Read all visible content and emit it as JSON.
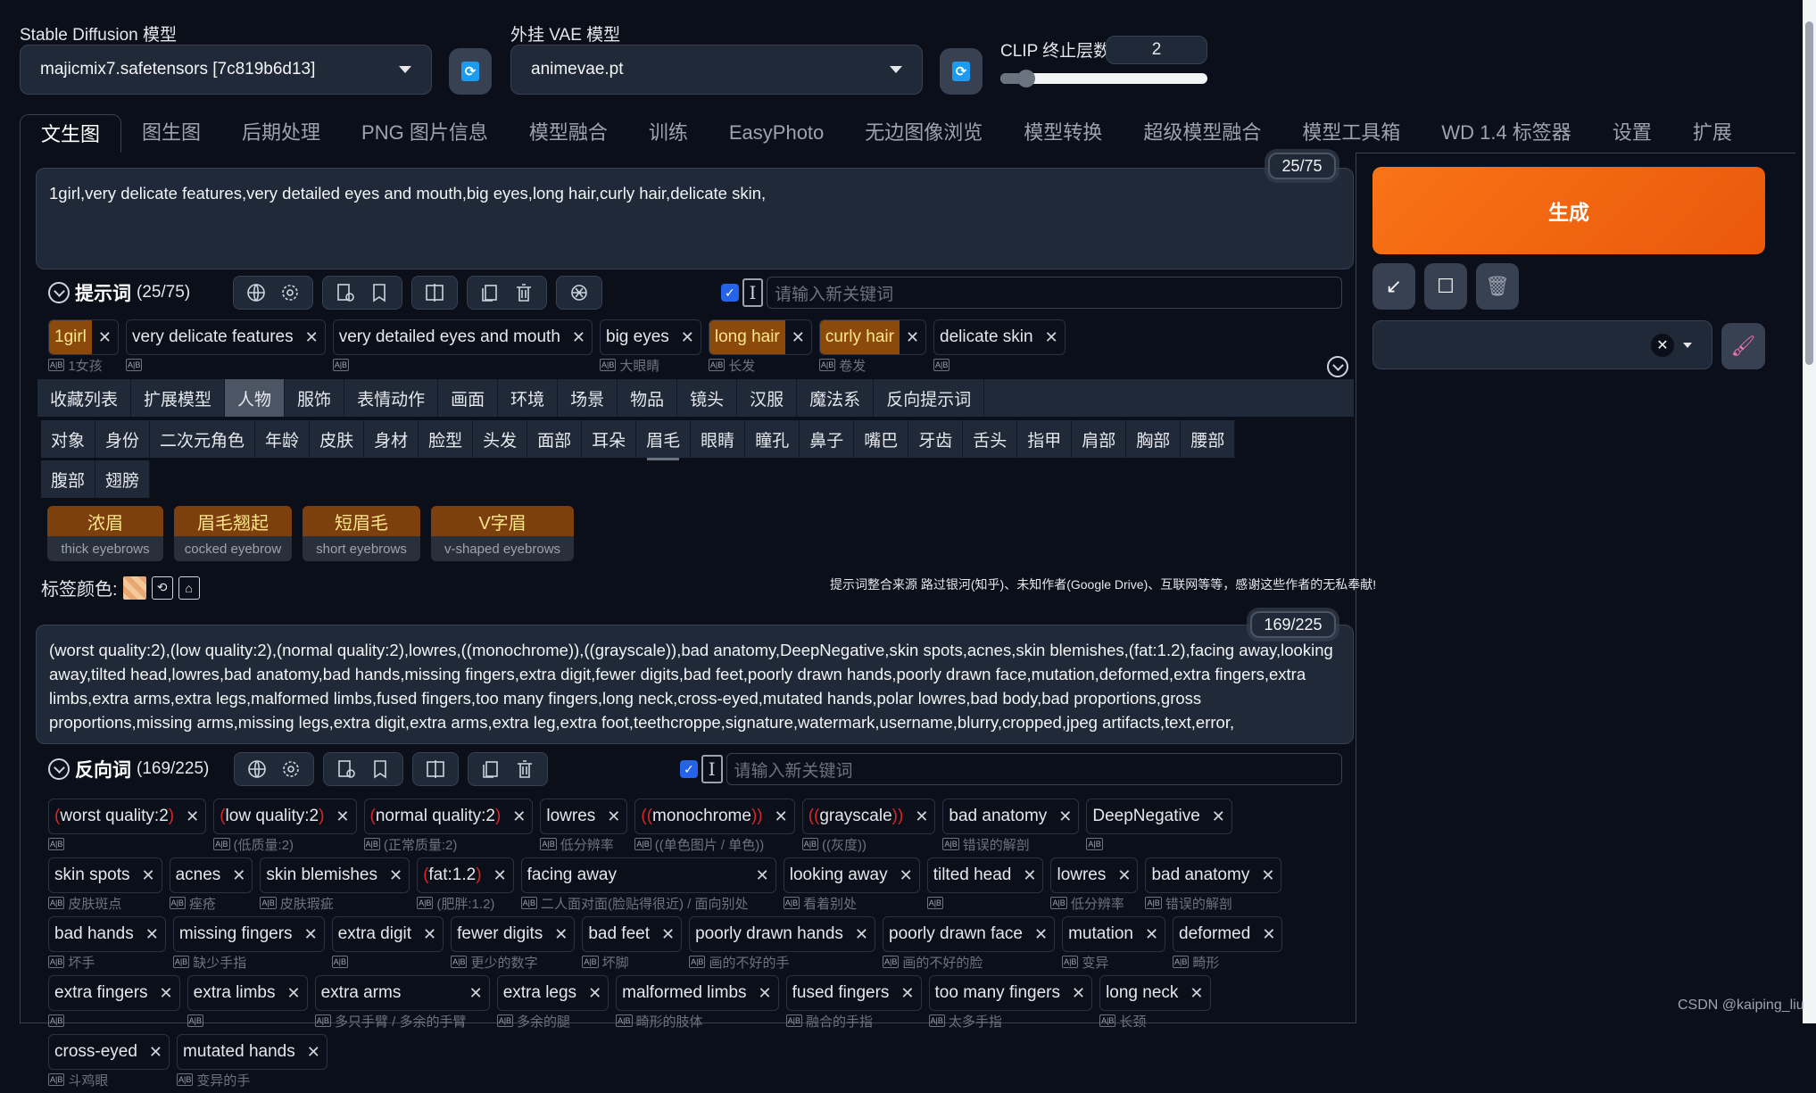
{
  "header": {
    "sd_model_label": "Stable Diffusion 模型",
    "sd_model_value": "majicmix7.safetensors [7c819b6d13]",
    "vae_label": "外挂 VAE 模型",
    "vae_value": "animevae.pt",
    "clip_label": "CLIP 终止层数",
    "clip_value": "2",
    "clip_slider_fraction": 0.08
  },
  "tabs": [
    "文生图",
    "图生图",
    "后期处理",
    "PNG 图片信息",
    "模型融合",
    "训练",
    "EasyPhoto",
    "无边图像浏览",
    "模型转换",
    "超级模型融合",
    "模型工具箱",
    "WD 1.4 标签器",
    "设置",
    "扩展"
  ],
  "active_tab": "文生图",
  "prompt": {
    "text": "1girl,very delicate features,very detailed eyes and mouth,big eyes,long hair,curly hair,delicate skin,",
    "token_count": "25/75",
    "section_title": "提示词",
    "section_count": "(25/75)",
    "keyword_placeholder": "请输入新关键词",
    "tags": [
      {
        "text": "1girl",
        "trans": "1女孩",
        "highlight": true
      },
      {
        "text": "very delicate features",
        "trans": "",
        "highlight": false
      },
      {
        "text": "very detailed eyes and mouth",
        "trans": "",
        "highlight": false
      },
      {
        "text": "big eyes",
        "trans": "大眼睛",
        "highlight": false
      },
      {
        "text": "long hair",
        "trans": "长发",
        "highlight": true
      },
      {
        "text": "curly hair",
        "trans": "卷发",
        "highlight": true
      },
      {
        "text": "delicate skin",
        "trans": "",
        "highlight": false
      }
    ]
  },
  "categories": [
    "收藏列表",
    "扩展模型",
    "人物",
    "服饰",
    "表情动作",
    "画面",
    "环境",
    "场景",
    "物品",
    "镜头",
    "汉服",
    "魔法系",
    "反向提示词"
  ],
  "active_category": "人物",
  "subcategories": [
    "对象",
    "身份",
    "二次元角色",
    "年龄",
    "皮肤",
    "身材",
    "脸型",
    "头发",
    "面部",
    "耳朵",
    "眉毛",
    "眼睛",
    "瞳孔",
    "鼻子",
    "嘴巴",
    "牙齿",
    "舌头",
    "指甲",
    "肩部",
    "胸部",
    "腰部",
    "腹部",
    "翅膀"
  ],
  "active_subcategory": "眉毛",
  "cards": [
    {
      "zh": "浓眉",
      "en": "thick eyebrows"
    },
    {
      "zh": "眉毛翘起",
      "en": "cocked eyebrow"
    },
    {
      "zh": "短眉毛",
      "en": "short eyebrows"
    },
    {
      "zh": "V字眉",
      "en": "v-shaped eyebrows"
    }
  ],
  "tag_color_label": "标签颜色:",
  "credits": "提示词整合来源 路过银河(知乎)、未知作者(Google Drive)、互联网等等，感谢这些作者的无私奉献!",
  "negative": {
    "text": "(worst quality:2),(low quality:2),(normal quality:2),lowres,((monochrome)),((grayscale)),bad anatomy,DeepNegative,skin spots,acnes,skin blemishes,(fat:1.2),facing away,looking away,tilted head,lowres,bad anatomy,bad hands,missing fingers,extra digit,fewer digits,bad feet,poorly drawn hands,poorly drawn face,mutation,deformed,extra fingers,extra limbs,extra arms,extra legs,malformed limbs,fused fingers,too many fingers,long neck,cross-eyed,mutated hands,polar lowres,bad body,bad proportions,gross proportions,missing arms,missing legs,extra digit,extra arms,extra leg,extra foot,teethcroppe,signature,watermark,username,blurry,cropped,jpeg artifacts,text,error,",
    "token_count": "169/225",
    "section_title": "反向词",
    "section_count": "(169/225)",
    "keyword_placeholder": "请输入新关键词",
    "tags": [
      {
        "pre": "(",
        "text": "worst quality:2",
        "post": ")",
        "trans": ""
      },
      {
        "pre": "(",
        "text": "low quality:2",
        "post": ")",
        "trans": "(低质量:2)"
      },
      {
        "pre": "(",
        "text": "normal quality:2",
        "post": ")",
        "trans": "(正常质量:2)"
      },
      {
        "pre": "",
        "text": "lowres",
        "post": "",
        "trans": "低分辨率"
      },
      {
        "pre": "((",
        "text": "monochrome",
        "post": "))",
        "trans": "((单色图片 / 单色))"
      },
      {
        "pre": "((",
        "text": "grayscale",
        "post": "))",
        "trans": "((灰度))"
      },
      {
        "pre": "",
        "text": "bad anatomy",
        "post": "",
        "trans": "错误的解剖"
      },
      {
        "pre": "",
        "text": "DeepNegative",
        "post": "",
        "trans": ""
      },
      {
        "pre": "",
        "text": "skin spots",
        "post": "",
        "trans": "皮肤斑点"
      },
      {
        "pre": "",
        "text": "acnes",
        "post": "",
        "trans": "痤疮"
      },
      {
        "pre": "",
        "text": "skin blemishes",
        "post": "",
        "trans": "皮肤瑕疵"
      },
      {
        "pre": "(",
        "text": "fat:1.2",
        "post": ")",
        "trans": "(肥胖:1.2)"
      },
      {
        "pre": "",
        "text": "facing away",
        "post": "",
        "trans": "二人面对面(脸贴得很近) / 面向别处"
      },
      {
        "pre": "",
        "text": "looking away",
        "post": "",
        "trans": "看着别处"
      },
      {
        "pre": "",
        "text": "tilted head",
        "post": "",
        "trans": ""
      },
      {
        "pre": "",
        "text": "lowres",
        "post": "",
        "trans": "低分辨率"
      },
      {
        "pre": "",
        "text": "bad anatomy",
        "post": "",
        "trans": "错误的解剖"
      },
      {
        "pre": "",
        "text": "bad hands",
        "post": "",
        "trans": "坏手"
      },
      {
        "pre": "",
        "text": "missing fingers",
        "post": "",
        "trans": "缺少手指"
      },
      {
        "pre": "",
        "text": "extra digit",
        "post": "",
        "trans": ""
      },
      {
        "pre": "",
        "text": "fewer digits",
        "post": "",
        "trans": "更少的数字"
      },
      {
        "pre": "",
        "text": "bad feet",
        "post": "",
        "trans": "坏脚"
      },
      {
        "pre": "",
        "text": "poorly drawn hands",
        "post": "",
        "trans": "画的不好的手"
      },
      {
        "pre": "",
        "text": "poorly drawn face",
        "post": "",
        "trans": "画的不好的脸"
      },
      {
        "pre": "",
        "text": "mutation",
        "post": "",
        "trans": "变异"
      },
      {
        "pre": "",
        "text": "deformed",
        "post": "",
        "trans": "畸形"
      },
      {
        "pre": "",
        "text": "extra fingers",
        "post": "",
        "trans": ""
      },
      {
        "pre": "",
        "text": "extra limbs",
        "post": "",
        "trans": ""
      },
      {
        "pre": "",
        "text": "extra arms",
        "post": "",
        "trans": "多只手臂 / 多余的手臂"
      },
      {
        "pre": "",
        "text": "extra legs",
        "post": "",
        "trans": "多余的腿"
      },
      {
        "pre": "",
        "text": "malformed limbs",
        "post": "",
        "trans": "畸形的肢体"
      },
      {
        "pre": "",
        "text": "fused fingers",
        "post": "",
        "trans": "融合的手指"
      },
      {
        "pre": "",
        "text": "too many fingers",
        "post": "",
        "trans": "太多手指"
      },
      {
        "pre": "",
        "text": "long neck",
        "post": "",
        "trans": "长颈"
      },
      {
        "pre": "",
        "text": "cross-eyed",
        "post": "",
        "trans": "斗鸡眼"
      },
      {
        "pre": "",
        "text": "mutated hands",
        "post": "",
        "trans": "变异的手"
      }
    ]
  },
  "right_panel": {
    "generate_label": "生成",
    "style_value": ""
  },
  "watermark": "CSDN @kaiping_liu",
  "colors": {
    "accent_orange": "#f97316",
    "tag_highlight": "#8b4a0c",
    "checkbox_blue": "#2563eb",
    "refresh_blue": "#1d9bf0"
  }
}
